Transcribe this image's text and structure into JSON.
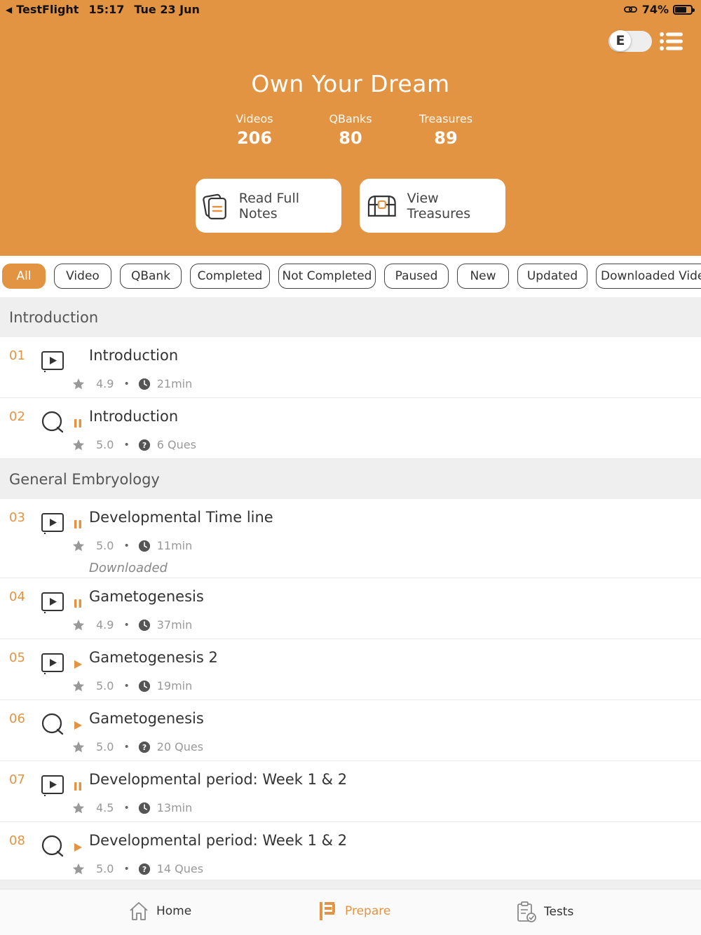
{
  "status_bar": {
    "app": "TestFlight",
    "time": "15:17",
    "date": "Tue 23 Jun",
    "battery": "74%",
    "battery_level": 0.74
  },
  "header": {
    "toggle_letter": "E",
    "title": "Own Your Dream",
    "stats": [
      {
        "label": "Videos",
        "value": "206"
      },
      {
        "label": "QBanks",
        "value": "80"
      },
      {
        "label": "Treasures",
        "value": "89"
      }
    ],
    "buttons": {
      "notes": "Read Full Notes",
      "treasures": "View Treasures"
    }
  },
  "filters": [
    "All",
    "Video",
    "QBank",
    "Completed",
    "Not Completed",
    "Paused",
    "New",
    "Updated",
    "Downloaded Videos"
  ],
  "sections": [
    {
      "title": "Introduction"
    },
    {
      "title": "General Embryology"
    }
  ],
  "items": [
    {
      "num": "01",
      "type": "video",
      "status": "none",
      "title": "Introduction",
      "rating": "4.9",
      "meta_icon": "clock-icon",
      "meta": "21min",
      "extra": ""
    },
    {
      "num": "02",
      "type": "qbank",
      "status": "paused",
      "title": "Introduction",
      "rating": "5.0",
      "meta_icon": "question-icon",
      "meta": "6 Ques",
      "extra": ""
    },
    {
      "num": "03",
      "type": "video",
      "status": "paused",
      "title": "Developmental Time line",
      "rating": "5.0",
      "meta_icon": "clock-icon",
      "meta": "11min",
      "extra": "Downloaded"
    },
    {
      "num": "04",
      "type": "video",
      "status": "paused",
      "title": "Gametogenesis",
      "rating": "4.9",
      "meta_icon": "clock-icon",
      "meta": "37min",
      "extra": ""
    },
    {
      "num": "05",
      "type": "video",
      "status": "play",
      "title": "Gametogenesis 2",
      "rating": "5.0",
      "meta_icon": "clock-icon",
      "meta": "19min",
      "extra": ""
    },
    {
      "num": "06",
      "type": "qbank",
      "status": "play",
      "title": "Gametogenesis",
      "rating": "5.0",
      "meta_icon": "question-icon",
      "meta": "20 Ques",
      "extra": ""
    },
    {
      "num": "07",
      "type": "video",
      "status": "paused",
      "title": "Developmental period: Week 1 & 2",
      "rating": "4.5",
      "meta_icon": "clock-icon",
      "meta": "13min",
      "extra": ""
    },
    {
      "num": "08",
      "type": "qbank",
      "status": "play",
      "title": "Developmental period: Week 1 & 2",
      "rating": "5.0",
      "meta_icon": "question-icon",
      "meta": "14 Ques",
      "extra": ""
    }
  ],
  "tabs": [
    {
      "label": "Home",
      "icon": "home-icon"
    },
    {
      "label": "Prepare",
      "icon": "prepare-icon",
      "active": true
    },
    {
      "label": "Tests",
      "icon": "tests-icon"
    }
  ],
  "colors": {
    "accent": "#E29443"
  }
}
